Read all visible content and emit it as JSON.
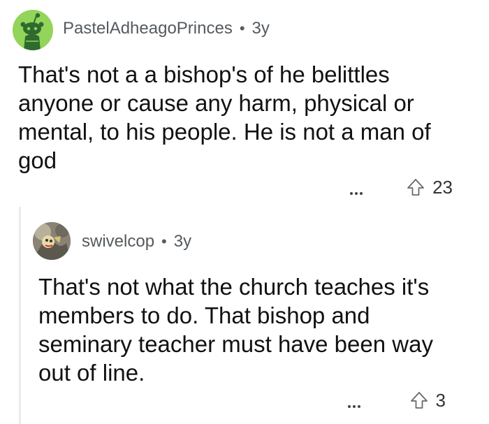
{
  "parent_comment": {
    "author": "PastelAdheagoPrinces",
    "separator": "•",
    "age": "3y",
    "body": "That's not a a bishop's of he belittles anyone or cause any harm, physical or mental, to his people. He is not a man of god",
    "votes": "23",
    "avatar_icon": "snoo-avatar-icon",
    "avatar_color": "#93d45a"
  },
  "reply_comment": {
    "author": "swivelcop",
    "separator": "•",
    "age": "3y",
    "body": "That's not what the church teaches it's members to do. That bishop and seminary teacher must have been way out of line.",
    "votes": "3",
    "avatar_icon": "user-photo-avatar"
  },
  "icons": {
    "more": "more-options-icon",
    "upvote": "upvote-arrow-icon"
  }
}
